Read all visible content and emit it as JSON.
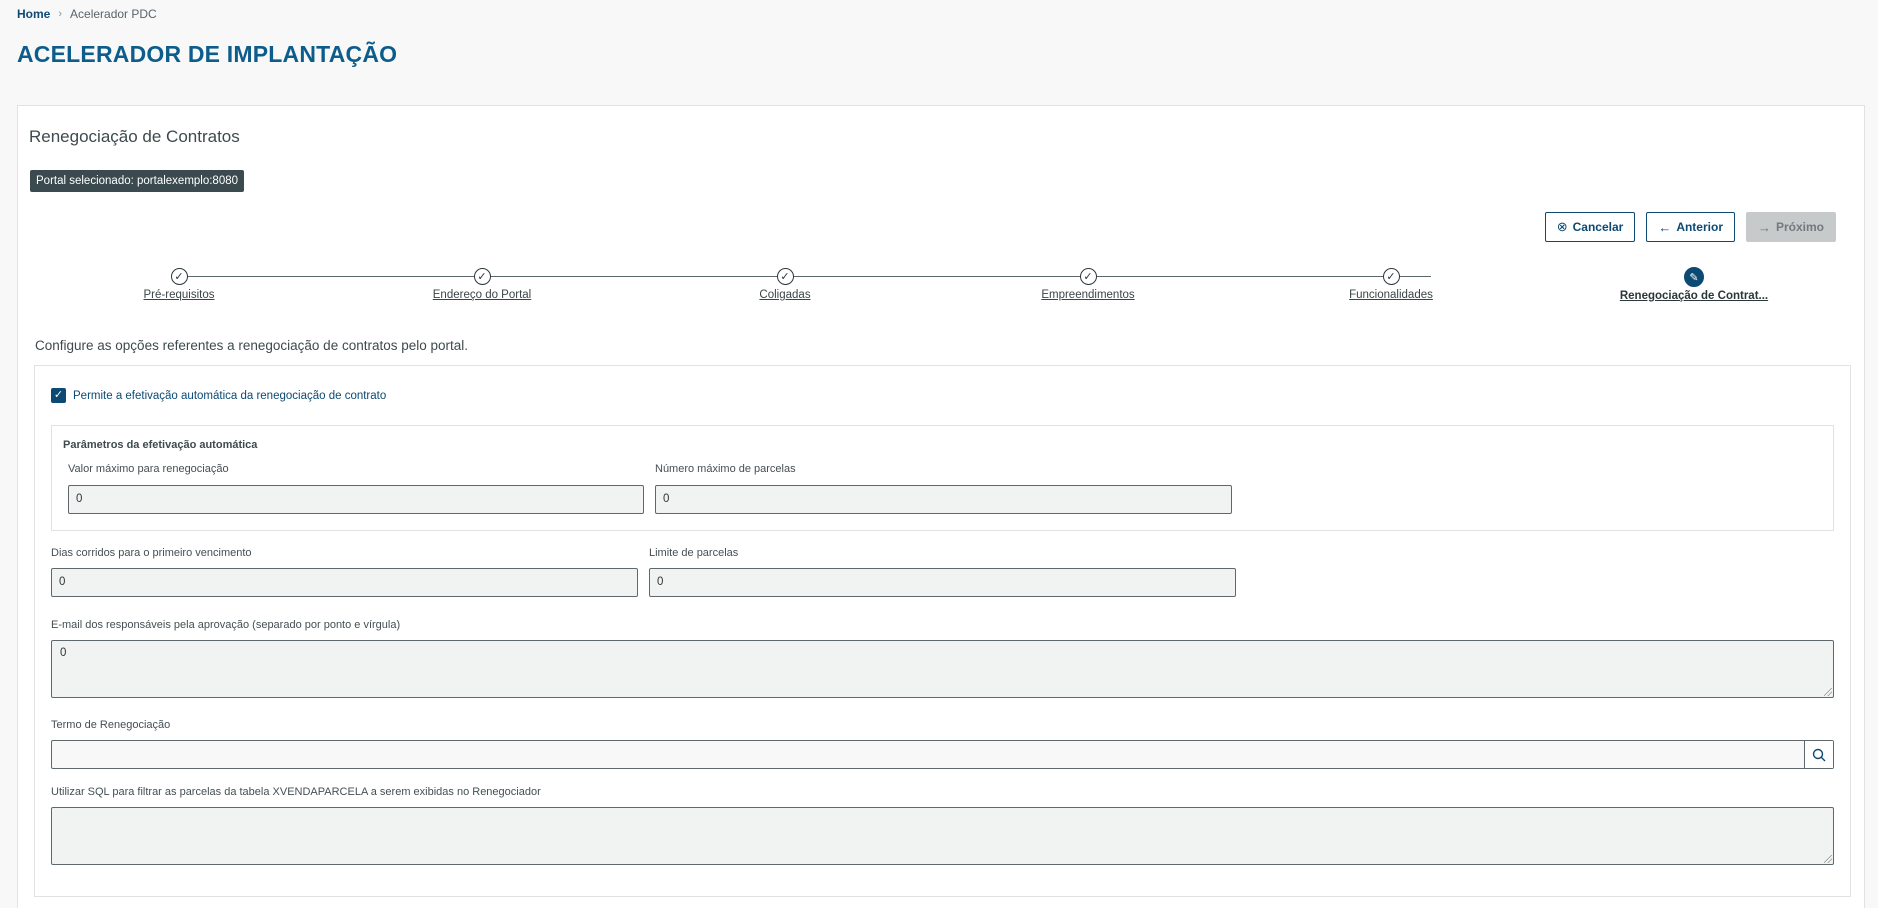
{
  "breadcrumb": {
    "home": "Home",
    "separator": "›",
    "current": "Acelerador PDC"
  },
  "page_title": "ACELERADOR DE IMPLANTAÇÃO",
  "card": {
    "title": "Renegociação de Contratos",
    "portal_tag": "Portal selecionado: portalexemplo:8080"
  },
  "actions": {
    "cancel": "Cancelar",
    "previous": "Anterior",
    "next": "Próximo",
    "cancel_icon": "⊗",
    "previous_icon": "←",
    "next_icon": "→"
  },
  "stepper": {
    "steps": [
      {
        "label": "Pré-requisitos",
        "icon": "check-icon",
        "glyph": "✓"
      },
      {
        "label": "Endereço do Portal",
        "icon": "check-icon",
        "glyph": "✓"
      },
      {
        "label": "Coligadas",
        "icon": "check-icon",
        "glyph": "✓"
      },
      {
        "label": "Empreendimentos",
        "icon": "check-icon",
        "glyph": "✓"
      },
      {
        "label": "Funcionalidades",
        "icon": "check-icon",
        "glyph": "✓"
      },
      {
        "label": "Renegociação de Contrat...",
        "icon": "pencil-icon",
        "glyph": "✎"
      }
    ]
  },
  "description": "Configure as opções referentes a renegociação de contratos pelo portal.",
  "form": {
    "auto_checkbox": {
      "label": "Permite a efetivação automática da renegociação de contrato",
      "checked": true,
      "glyph": "✓"
    },
    "fieldset_title": "Parâmetros da efetivação automática",
    "valor_maximo": {
      "label": "Valor máximo para renegociação",
      "value": "0"
    },
    "numero_maximo": {
      "label": "Número máximo de parcelas",
      "value": "0"
    },
    "dias_corridos": {
      "label": "Dias corridos para o primeiro vencimento",
      "value": "0"
    },
    "limite_parcelas": {
      "label": "Limite de parcelas",
      "value": "0"
    },
    "emails": {
      "label": "E-mail dos responsáveis pela aprovação (separado por ponto e vírgula)",
      "value": "0"
    },
    "termo": {
      "label": "Termo de Renegociação",
      "value": ""
    },
    "sql": {
      "label": "Utilizar SQL para filtrar as parcelas da tabela XVENDAPARCELA a serem exibidas no Renegociador",
      "value": ""
    }
  },
  "colors": {
    "primary": "#0c4a73",
    "title": "#0c5c8c",
    "tag_bg": "#3a4a4f",
    "input_bg": "#f1f2f2"
  }
}
